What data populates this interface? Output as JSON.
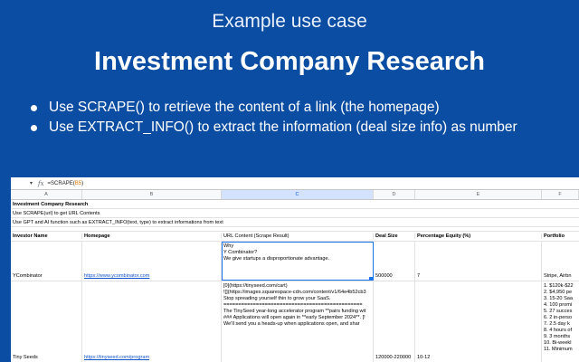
{
  "slide": {
    "subtitle": "Example use case",
    "title": "Investment Company Research",
    "bullets": [
      "Use SCRAPE() to retrieve the content of a link (the homepage)",
      "Use EXTRACT_INFO()  to extract the information (deal size info) as number"
    ]
  },
  "sheet": {
    "formula_prefix": "=SCRAPE(",
    "formula_ref": "B5",
    "formula_suffix": ")",
    "fx": "fx",
    "columns": [
      "A",
      "B",
      "C",
      "D",
      "E",
      "F"
    ],
    "selected_column": "C",
    "info_rows": [
      "Investment Company Research",
      "Use SCRAPE(url) to get URL Contents",
      "Use GPT and AI function such as EXTRACT_INFO(text, type) to extract informations from text"
    ],
    "headers": [
      "Investor Name",
      "Homepage",
      "URL Content (Scrape Result)",
      "Deal Size",
      "Percentage Equity (%)",
      "Portfolio"
    ],
    "rows": [
      {
        "name": "YCombinator",
        "homepage": "https://www.ycombinator.com",
        "content": [
          "Why",
          "",
          "Y Combinator?",
          "",
          "We give startups a disproportionate advantage."
        ],
        "deal_size": "500000",
        "equity": "7",
        "portfolio": [
          "Stripe, Airbn"
        ]
      },
      {
        "name": "Tiny Seeds",
        "homepage": "https://tinyseed.com/program",
        "content": [
          "[0](https://tinyseed.com/cart)",
          "",
          "![](https://images.squarespace-cdn.com/content/v1/64e4b52cb3",
          "",
          "Stop spreading yourself thin to grow your SaaS.",
          "===============================================",
          "",
          "The TinySeed year-long accelerator program **pairs funding wit",
          "",
          "### Applications will open again in **early September 2024**. [!",
          "",
          "We'll send you a heads-up when applications open, and shar"
        ],
        "deal_size": "120000-220000",
        "equity": "10-12",
        "portfolio": [
          "1. $120k-$22",
          "2. $4,950 pe",
          "3. 15-20 Saa",
          "4. 100 promi",
          "5. 27 succes",
          "6. 2 in-perso",
          "7. 2.5 day k",
          "8. 4 hours of",
          "9. 3 months",
          "10. Bi-weekl",
          "11. Minimum"
        ]
      }
    ]
  }
}
